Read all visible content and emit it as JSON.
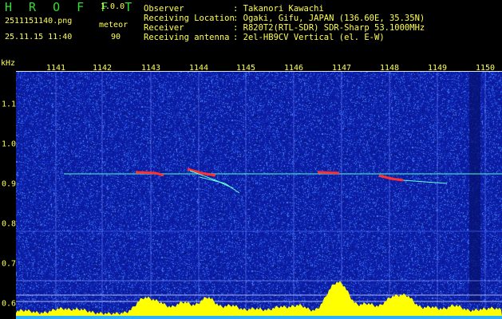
{
  "header": {
    "app_name": "H R O F F T",
    "version": "1.0.0",
    "filename": "2511151140.png",
    "event_type": "meteor",
    "date_time": "25.11.15 11:40",
    "count": "90"
  },
  "info": {
    "observer_label": "Observer",
    "observer_value": ": Takanori Kawachi",
    "location_label": "Receiving Location",
    "location_value": ": Ogaki, Gifu, JAPAN (136.60E, 35.35N)",
    "receiver_label": "Receiver",
    "receiver_value": ": R820T2(RTL-SDR) SDR-Sharp 53.1000MHz",
    "antenna_label": "Receiving antenna",
    "antenna_value": ": 2el-HB9CV Vertical (el. E-W)"
  },
  "axis": {
    "y_unit": "kHz",
    "minute_labels": [
      "1141",
      "1142",
      "1143",
      "1144",
      "1145",
      "1146",
      "1147",
      "1148",
      "1149",
      "1150"
    ],
    "freq_labels": [
      "1.1",
      "1.0",
      "0.9",
      "0.8",
      "0.7",
      "0.6"
    ]
  },
  "colors": {
    "background": "#0c1ea8",
    "text": "#ffff55",
    "title": "#33dd33",
    "echo": "#ff3030",
    "carrier": "#40e0c0",
    "activity": "#ffff00"
  }
}
